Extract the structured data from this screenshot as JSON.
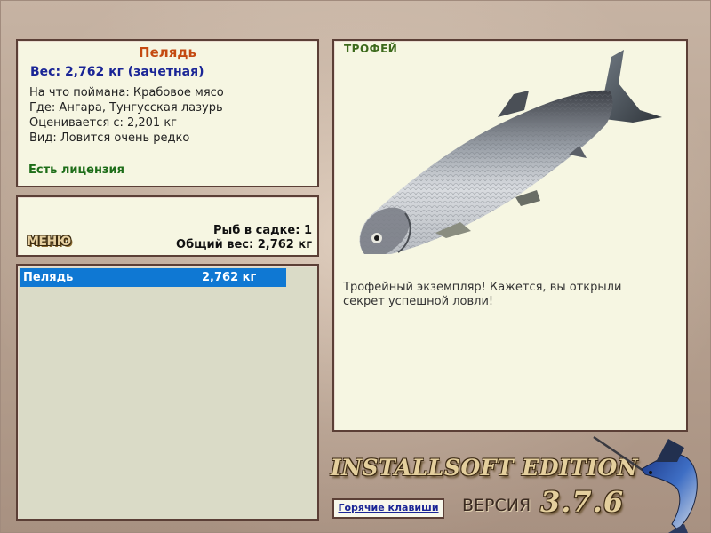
{
  "info": {
    "fish_name": "Пелядь",
    "weight_line": "Вес: 2,762 кг (зачетная)",
    "bait": "На что поймана: Крабовое мясо",
    "location": "Где: Ангара, Тунгусская лазурь",
    "rated_from": "Оценивается с: 2,201 кг",
    "rarity": "Вид: Ловится очень редко",
    "license": "Есть лицензия"
  },
  "menu": {
    "button_label": "МЕНЮ",
    "fish_in_keepnet": "Рыб в садке: 1",
    "total_weight": "Общий вес: 2,762 кг"
  },
  "catch_list": [
    {
      "name": "Пелядь",
      "weight": "2,762 кг"
    }
  ],
  "trophy": {
    "label": "ТРОФЕЙ",
    "text": "Трофейный экземпляр! Кажется, вы открыли секрет успешной ловли!"
  },
  "footer": {
    "edition": "INSTALLSOFT EDITION",
    "hotkeys": "Горячие клавиши",
    "version_label": "ВЕРСИЯ",
    "version_number": "3.7.6"
  },
  "colors": {
    "panel_bg": "#f6f6e2",
    "panel_border": "#5b3f36",
    "list_bg": "#dadbc7",
    "selection": "#0f78d3",
    "title": "#c44a11",
    "weight": "#1a2596",
    "license": "#1d6d18"
  },
  "icons": {
    "fish_image": "whitefish-peled-image",
    "logo": "marlin-logo-icon"
  }
}
